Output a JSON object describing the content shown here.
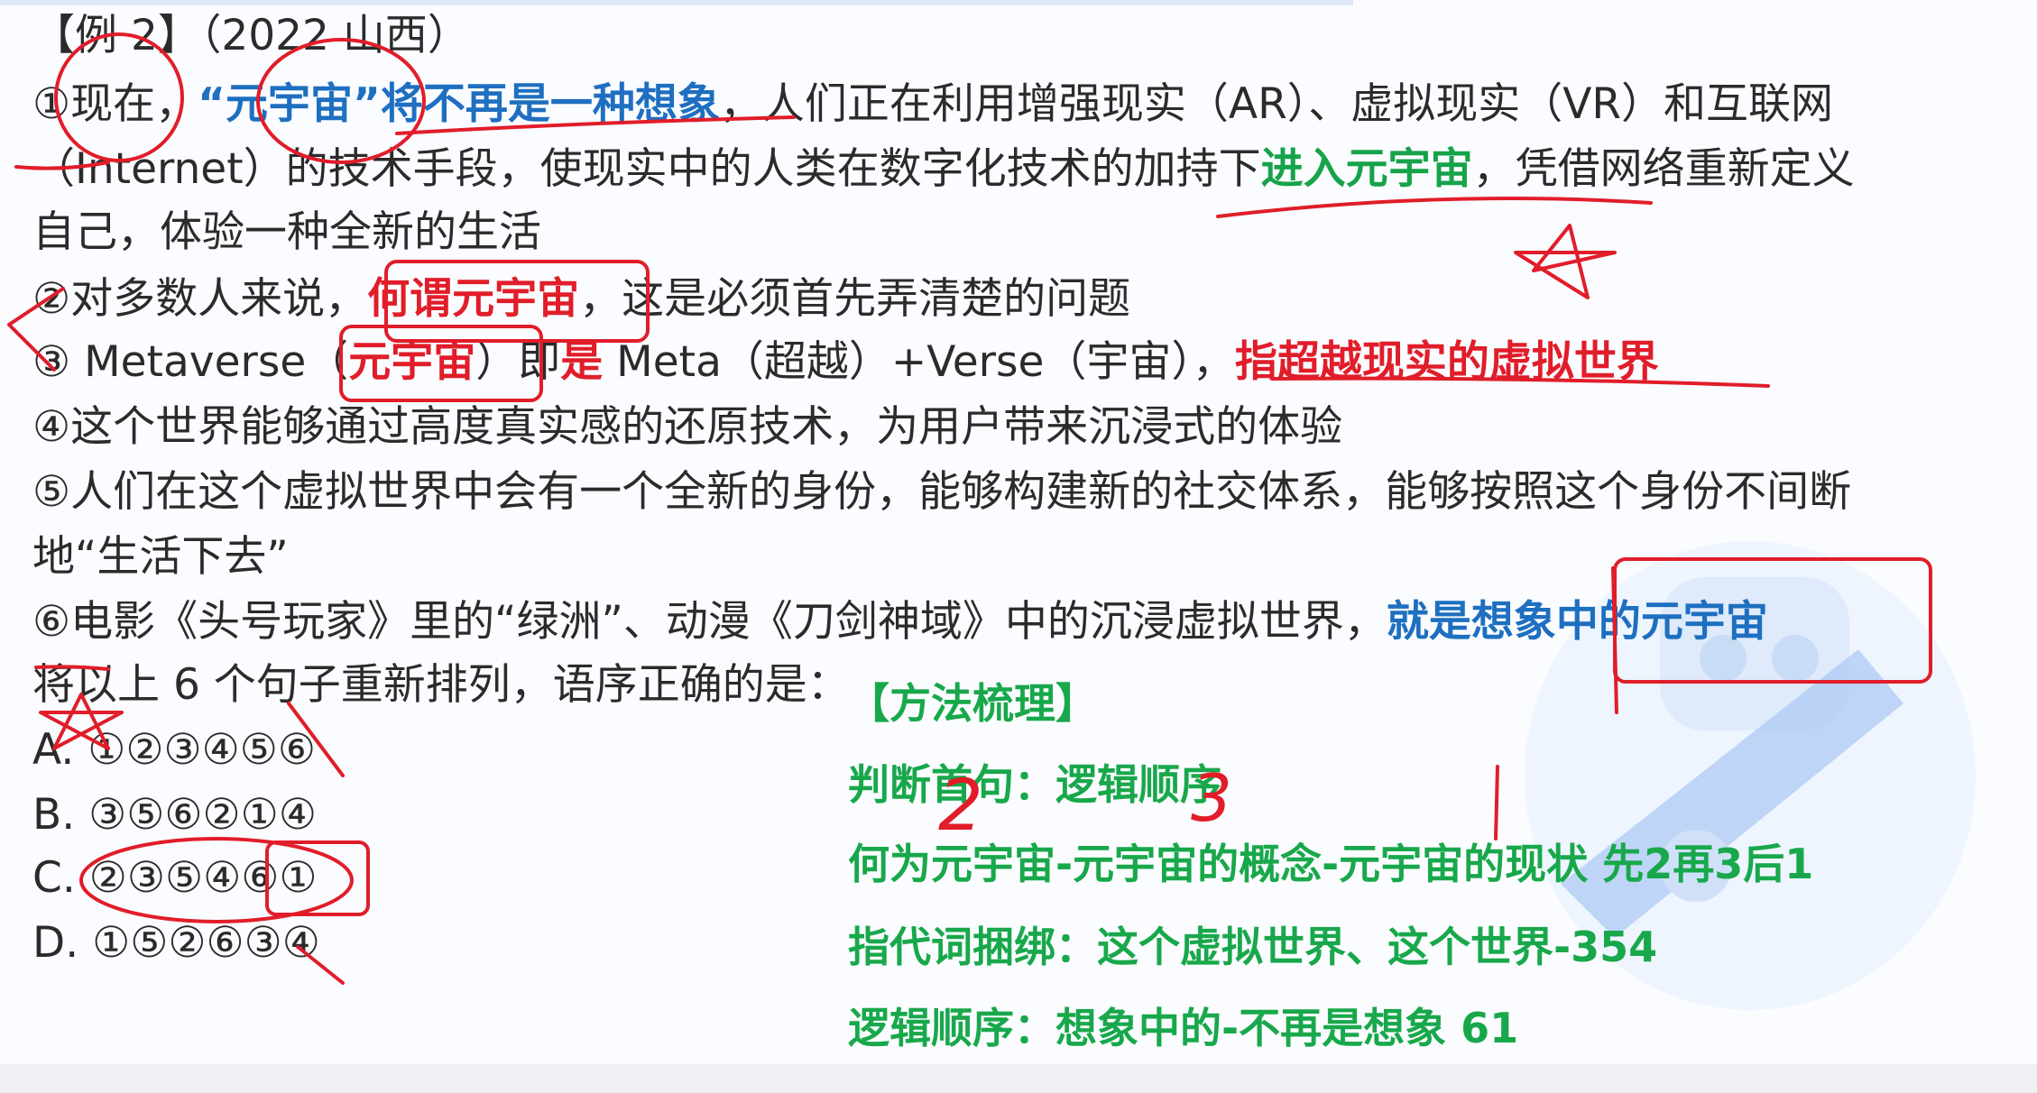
{
  "header": {
    "example": "【例 2】",
    "source": "（2022 山西）"
  },
  "sentences": {
    "s1": {
      "num": "①",
      "p1": "现在，",
      "highlight1": "“元宇宙”将不再是一种想象",
      "p2": "，人们正在利用增强现实（AR）、虚拟现实（VR）和互联网",
      "p3": "（Internet）的技术手段，使现实中的人类在数字化技术的加持下",
      "highlight2": "进入元宇宙",
      "p4": "，凭借网络重新定义",
      "p5": "自己，体验一种全新的生活"
    },
    "s2": {
      "num": "②",
      "p1": "对多数人来说，",
      "highlight": "何谓元宇宙",
      "p2": "，这是必须首先弄清楚的问题"
    },
    "s3": {
      "num": "③",
      "p1": " Metaverse（",
      "highlight1": "元宇宙",
      "p2": "）即",
      "highlight2": "是",
      "p3": " Meta（超越）+Verse（宇宙），",
      "highlight3": "指超越现实的虚拟世界"
    },
    "s4": {
      "num": "④",
      "text": "这个世界能够通过高度真实感的还原技术，为用户带来沉浸式的体验"
    },
    "s5": {
      "num": "⑤",
      "p1": "人们在这个虚拟世界中会有一个全新的身份，能够构建新的社交体系，能够按照这个身份不间断",
      "p2": "地“生活下去”"
    },
    "s6": {
      "num": "⑥",
      "p1": "电影《头号玩家》里的“绿洲”、动漫《刀剑神域》中的沉浸虚拟世界，",
      "highlight": "就是想象中的元宇宙"
    }
  },
  "question": "将以上 6 个句子重新排列，语序正确的是：",
  "options": [
    {
      "label": "A.",
      "text": "①②③④⑤⑥"
    },
    {
      "label": "B.",
      "text": "③⑤⑥②①④"
    },
    {
      "label": "C.",
      "text": "②③⑤④⑥①"
    },
    {
      "label": "D.",
      "text": "①⑤②⑥③④"
    }
  ],
  "method": {
    "title": "【方法梳理】",
    "line1": "判断首句：逻辑顺序",
    "line2": "何为元宇宙-元宇宙的概念-元宇宙的现状 先2再3后1",
    "line3": "指代词捆绑：这个虚拟世界、这个世界-354",
    "line4": "逻辑顺序：想象中的-不再是想象 61"
  },
  "annotations": {
    "digit2": "2",
    "digit3": "3"
  },
  "colors": {
    "blue": "#1e6fc0",
    "green": "#16a34a",
    "red_ink": "#e11d2a"
  }
}
